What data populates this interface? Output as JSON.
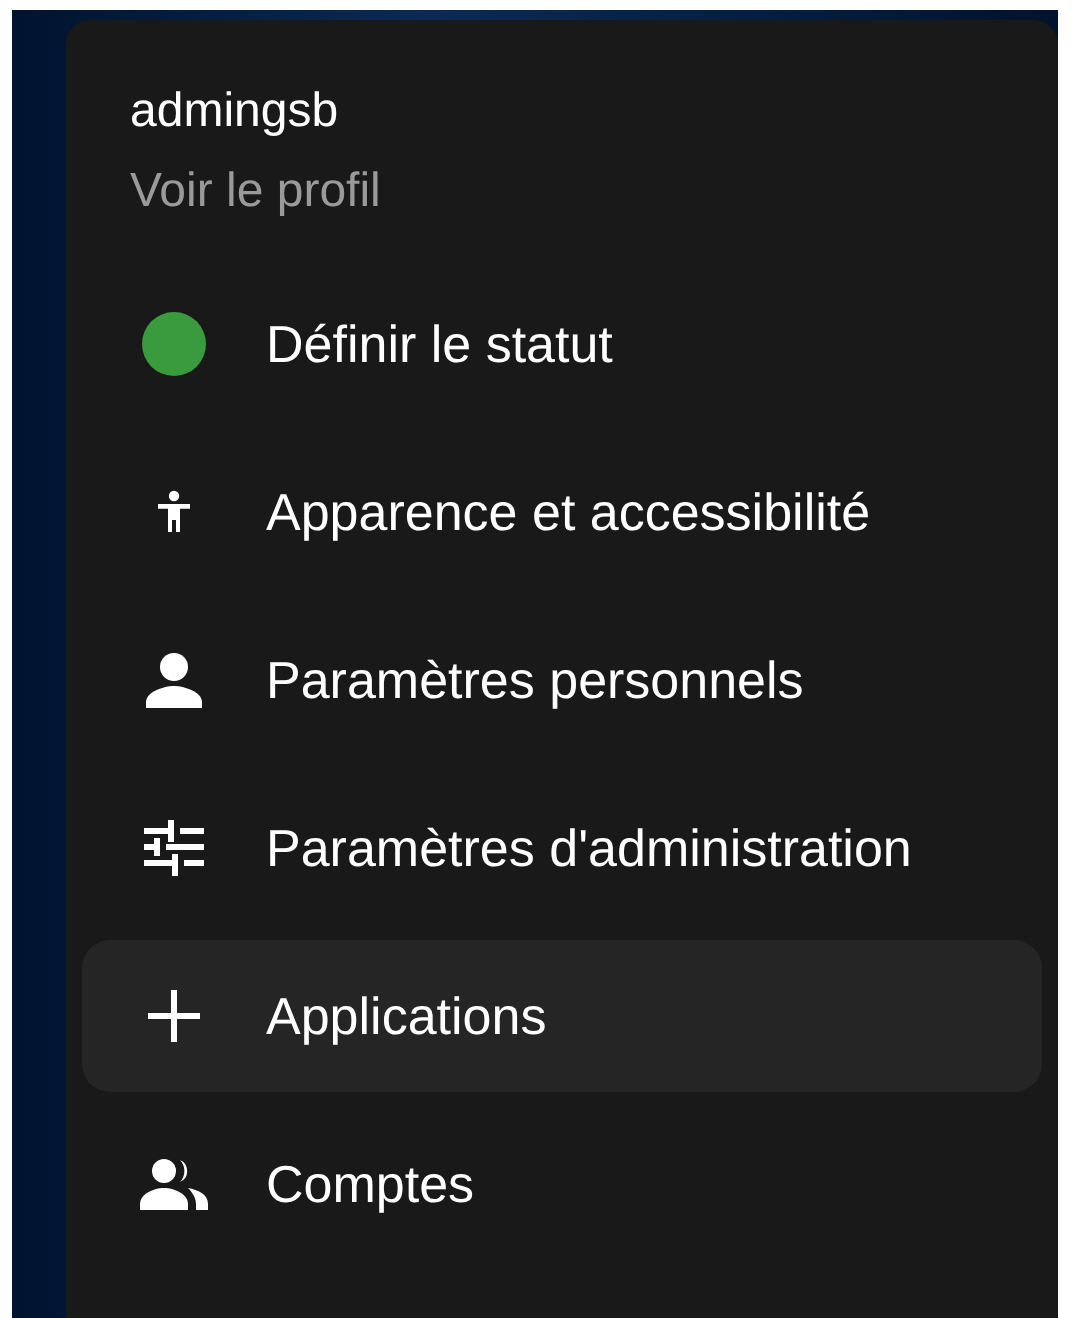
{
  "user": {
    "name": "admingsb",
    "profile_link": "Voir le profil"
  },
  "menu_items": [
    {
      "label": "Définir le statut",
      "kind": "status",
      "color": "#3a9a3e",
      "selected": false
    },
    {
      "label": "Apparence et accessibilité",
      "kind": "accessibility",
      "selected": false
    },
    {
      "label": "Paramètres personnels",
      "kind": "person",
      "selected": false
    },
    {
      "label": "Paramètres d'administration",
      "kind": "sliders",
      "selected": false
    },
    {
      "label": "Applications",
      "kind": "plus",
      "selected": true
    },
    {
      "label": "Comptes",
      "kind": "people",
      "selected": false
    }
  ]
}
